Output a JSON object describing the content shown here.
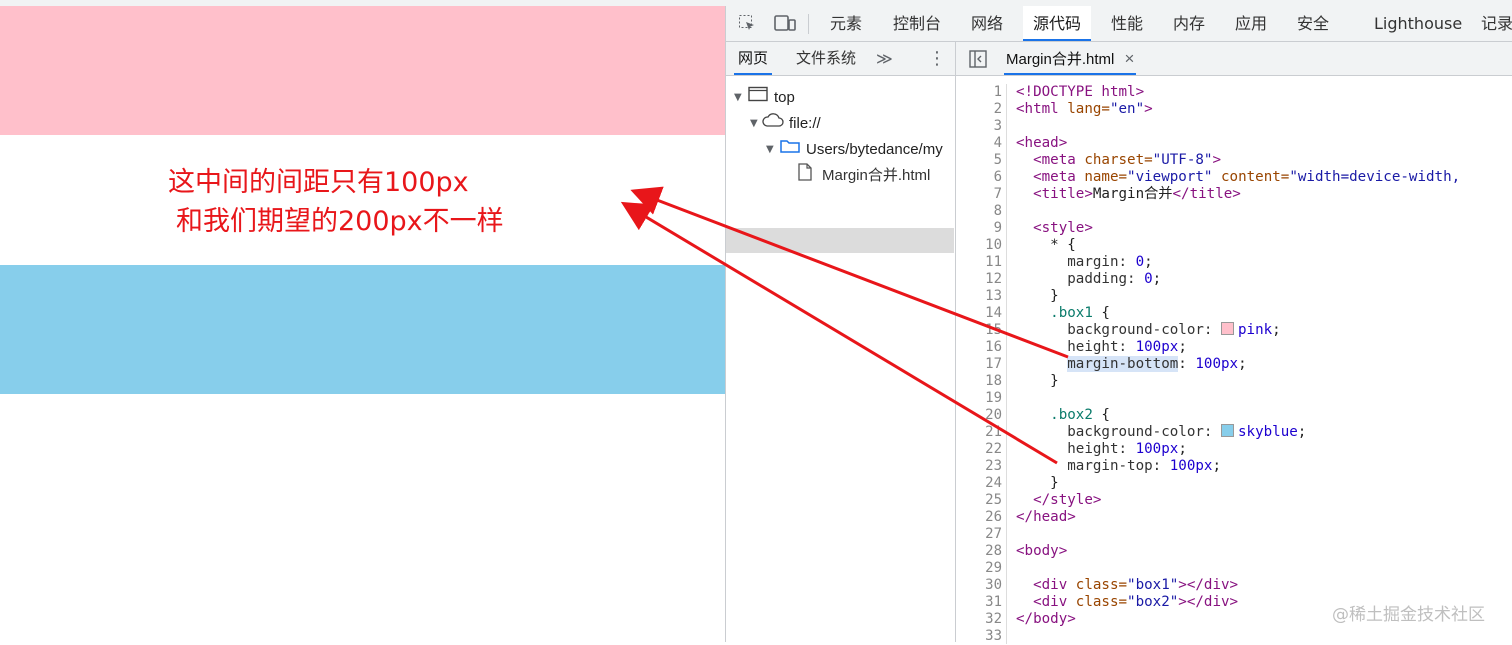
{
  "preview": {
    "annotation_line1": "这中间的间距只有100px",
    "annotation_line2": "和我们期望的200px不一样",
    "colors": {
      "box1": "#ffc0cb",
      "box2": "#87ceeb",
      "annotation": "#e8161a"
    }
  },
  "devtools": {
    "toolbar_icons": [
      "inspect-element-icon",
      "device-toolbar-icon"
    ],
    "tabs": [
      "元素",
      "控制台",
      "网络",
      "源代码",
      "性能",
      "内存",
      "应用",
      "安全",
      "Lighthouse",
      "记录"
    ],
    "active_tab": "源代码",
    "navigator": {
      "tabs": [
        "网页",
        "文件系统"
      ],
      "more": "≫",
      "menu": "⋮",
      "tree": [
        {
          "label": "top",
          "icon": "frame-icon"
        },
        {
          "label": "file://",
          "icon": "cloud-icon"
        },
        {
          "label": "Users/bytedance/my",
          "icon": "folder-icon"
        },
        {
          "label": "Margin合并.html",
          "icon": "file-icon"
        }
      ]
    },
    "editor": {
      "file_tab": "Margin合并.html",
      "close": "×",
      "line_numbers": [
        "1",
        "2",
        "3",
        "4",
        "5",
        "6",
        "7",
        "8",
        "9",
        "10",
        "11",
        "12",
        "13",
        "14",
        "15",
        "16",
        "17",
        "18",
        "19",
        "20",
        "21",
        "22",
        "23",
        "24",
        "25",
        "26",
        "27",
        "28",
        "29",
        "30",
        "31",
        "32",
        "33"
      ],
      "code": {
        "l1": "<!DOCTYPE html>",
        "l2_tag": "<html",
        "l2_attr": " lang=",
        "l2_val": "\"en\"",
        "l2_end": ">",
        "l4": "<head>",
        "l5_tag": "  <meta",
        "l5_attr": " charset=",
        "l5_val": "\"UTF-8\"",
        "l5_end": ">",
        "l6_tag": "  <meta",
        "l6_attr1": " name=",
        "l6_val1": "\"viewport\"",
        "l6_attr2": " content=",
        "l6_val2": "\"width=device-width,",
        "l7_open": "  <title>",
        "l7_text": "Margin合并",
        "l7_close": "</title>",
        "l9": "  <style>",
        "l10": "    * {",
        "l11_prop": "      margin: ",
        "l11_val": "0",
        "l11_end": ";",
        "l12_prop": "      padding: ",
        "l12_val": "0",
        "l12_end": ";",
        "l13": "    }",
        "l14_sel": "    .box1",
        "l14_end": " {",
        "l15_prop": "      background-color: ",
        "l15_val": "pink",
        "l15_end": ";",
        "l16_prop": "      height: ",
        "l16_val": "100px",
        "l16_end": ";",
        "l17_prop": "margin-bottom",
        "l17_colon": ": ",
        "l17_val": "100px",
        "l17_end": ";",
        "l18": "    }",
        "l20_sel": "    .box2",
        "l20_end": " {",
        "l21_prop": "      background-color: ",
        "l21_val": "skyblue",
        "l21_end": ";",
        "l22_prop": "      height: ",
        "l22_val": "100px",
        "l22_end": ";",
        "l23_prop": "      margin-top: ",
        "l23_val": "100px",
        "l23_end": ";",
        "l24": "    }",
        "l25": "  </style>",
        "l26": "</head>",
        "l28": "<body>",
        "l30_tag": "  <div",
        "l30_attr": " class=",
        "l30_val": "\"box1\"",
        "l30_end": "></div>",
        "l31_tag": "  <div",
        "l31_attr": " class=",
        "l31_val": "\"box2\"",
        "l31_end": "></div>",
        "l32": "</body>"
      }
    }
  },
  "watermark": "@稀土掘金技术社区"
}
